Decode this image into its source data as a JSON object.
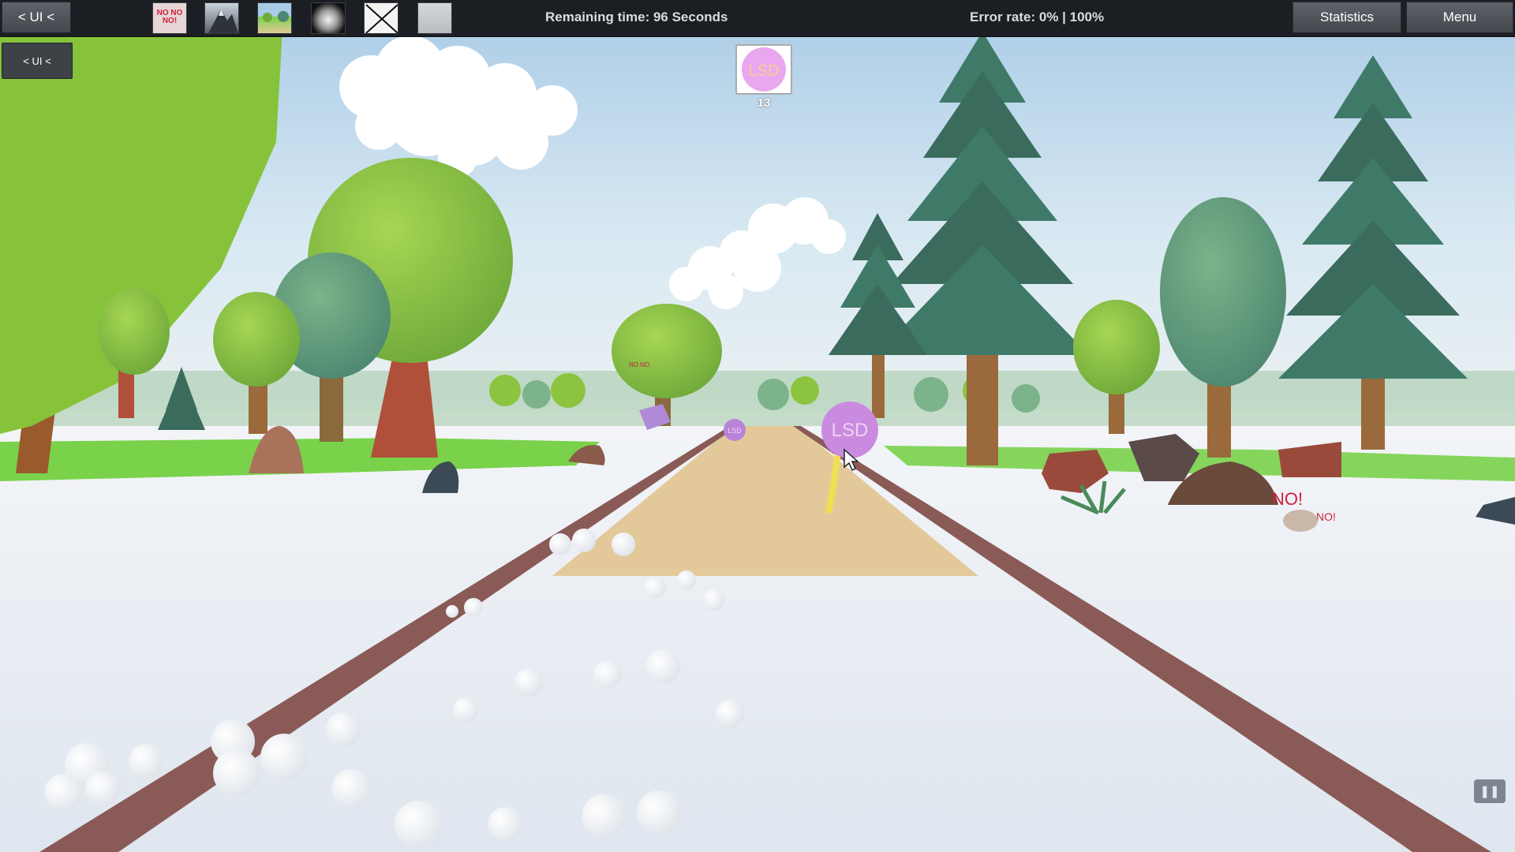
{
  "topbar": {
    "ui_toggle_label": "< UI <",
    "thumbnails": [
      {
        "name": "nono-thumbnail",
        "text": "NO NO NO!"
      },
      {
        "name": "mountain-thumbnail"
      },
      {
        "name": "landscape-thumbnail"
      },
      {
        "name": "dark-gradient-thumbnail"
      },
      {
        "name": "crossed-thumbnail"
      },
      {
        "name": "blank-thumbnail"
      }
    ],
    "remaining_time": "Remaining time: 96 Seconds",
    "error_rate": "Error rate: 0% | 100%",
    "statistics_label": "Statistics",
    "menu_label": "Menu"
  },
  "side_panel": {
    "ui_toggle_label": "< UI <"
  },
  "target": {
    "label": "LSD",
    "count": "13"
  },
  "scene": {
    "lsd_balloon_label": "LSD",
    "small_lsd_label": "LSD",
    "no_sign_text": "NO!",
    "no_sign_text_small": "NO!",
    "nono_far_text": "NO NO",
    "colors": {
      "sky_top": "#a9cbe6",
      "sky_horizon": "#e8eff2",
      "snow": "#e9eef4",
      "path_sand": "#e3c99a",
      "rail": "#8a5a57",
      "grass": "#79d24a",
      "tree_round": "#8cc43f",
      "tree_pine": "#3b6b5d",
      "lsd_balloon": "#c98be0",
      "lsd_text": "#f2d1ef"
    }
  },
  "pause_icon": "pause-icon"
}
